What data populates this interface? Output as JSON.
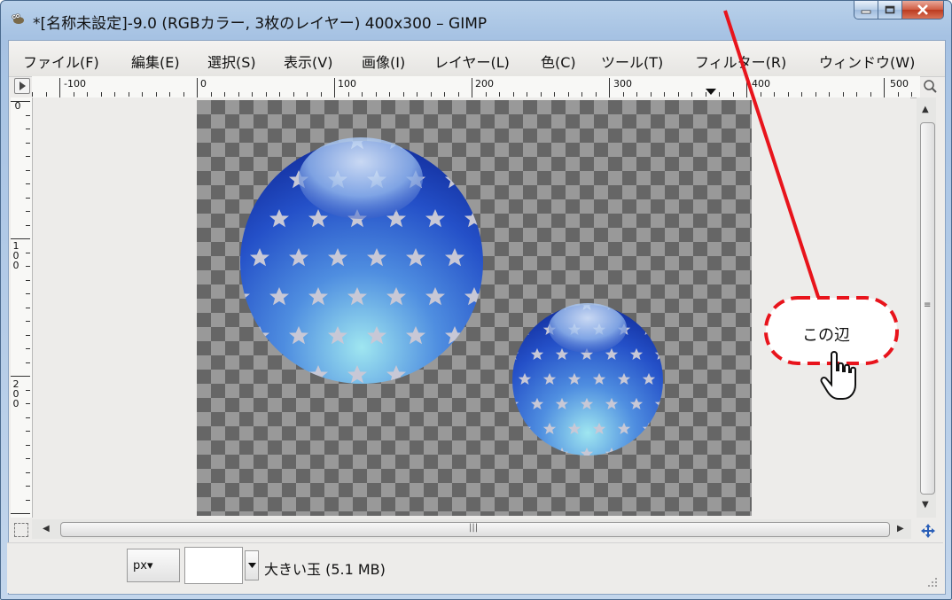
{
  "window": {
    "title": "*[名称未設定]-9.0 (RGBカラー, 3枚のレイヤー) 400x300 – GIMP",
    "icon": "gimp-wilber-icon",
    "controls": [
      "minimize-icon",
      "maximize-icon",
      "close-icon"
    ]
  },
  "menubar": {
    "items": [
      {
        "label": "ファイル(F)"
      },
      {
        "label": "編集(E)"
      },
      {
        "label": "選択(S)"
      },
      {
        "label": "表示(V)"
      },
      {
        "label": "画像(I)"
      },
      {
        "label": "レイヤー(L)"
      },
      {
        "label": "色(C)"
      },
      {
        "label": "ツール(T)"
      },
      {
        "label": "フィルター(R)"
      },
      {
        "label": "ウィンドウ(W)"
      }
    ]
  },
  "ruler_horizontal": {
    "labels": [
      "-100",
      "0",
      "100",
      "200",
      "300",
      "400",
      "500"
    ]
  },
  "ruler_vertical": {
    "labels": [
      "0",
      "100",
      "200"
    ]
  },
  "canvas": {
    "image_size": "400x300",
    "background": "transparent-checkerboard",
    "layers_visible": [
      "large-star-ball",
      "small-star-ball"
    ],
    "ball_color": "#1a3fb0",
    "star_color": "#c8c8d6"
  },
  "statusbar": {
    "unit": "px▾",
    "zoom_value": "",
    "layer_info": "大きい玉 (5.1 MB)"
  },
  "annotation": {
    "callout_text": "この辺",
    "line_color": "#e8141c",
    "callout_border_color": "#e8141c",
    "pointer": "hand-pointer-icon"
  },
  "colors": {
    "titlebar": "#b9d1ea",
    "client_bg": "#edecea",
    "checker_dark": "#666666",
    "checker_light": "#999999"
  }
}
